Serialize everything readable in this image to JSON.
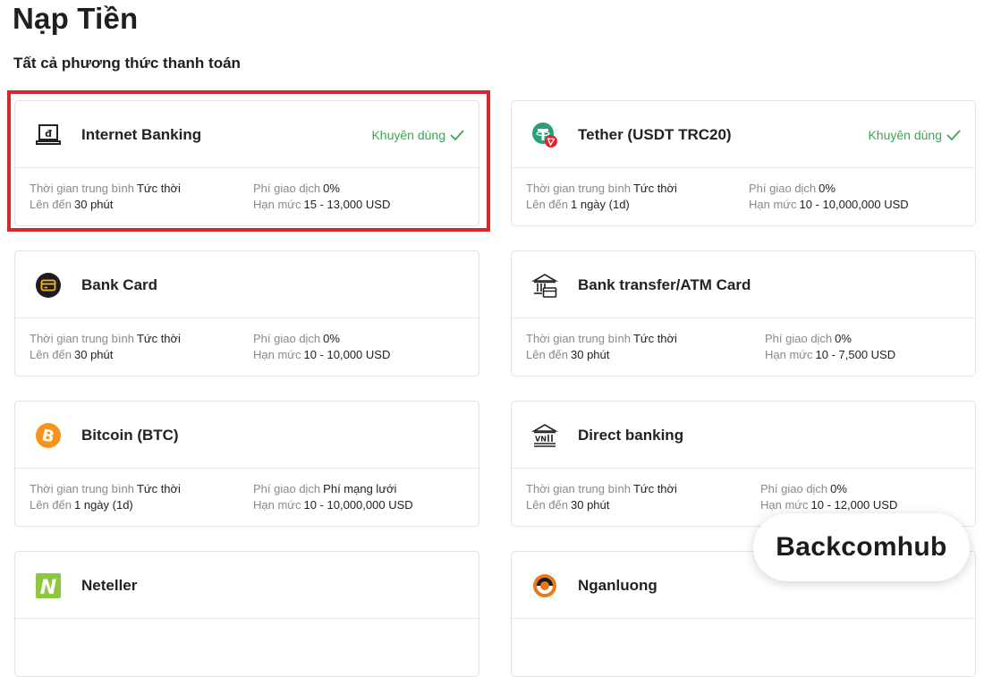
{
  "page": {
    "title": "Nạp Tiền",
    "section_title": "Tất cả phương thức thanh toán"
  },
  "labels": {
    "avg_time": "Thời gian trung bình",
    "up_to": "Lên đến",
    "fee": "Phí giao dịch",
    "limit": "Hạn mức"
  },
  "colors": {
    "recommended": "#3aa655",
    "highlight_border": "#d7262d"
  },
  "methods": [
    {
      "name": "Internet Banking",
      "icon": "laptop-dong-icon",
      "recommended": "Khuyên dùng",
      "avg_time": "Tức thời",
      "up_to": "30 phút",
      "fee": "0%",
      "limit": "15 - 13,000 USD"
    },
    {
      "name": "Tether (USDT TRC20)",
      "icon": "tether-icon",
      "recommended": "Khuyên dùng",
      "avg_time": "Tức thời",
      "up_to": "1 ngày (1d)",
      "fee": "0%",
      "limit": "10 - 10,000,000 USD"
    },
    {
      "name": "Bank Card",
      "icon": "card-icon",
      "avg_time": "Tức thời",
      "up_to": "30 phút",
      "fee": "0%",
      "limit": "10 - 10,000 USD"
    },
    {
      "name": "Bank transfer/ATM Card",
      "icon": "bank-building-icon",
      "avg_time": "Tức thời",
      "up_to": "30 phút",
      "fee": "0%",
      "limit": "10 - 7,500 USD"
    },
    {
      "name": "Bitcoin (BTC)",
      "icon": "bitcoin-icon",
      "avg_time": "Tức thời",
      "up_to": "1 ngày (1d)",
      "fee": "Phí mạng lưới",
      "limit": "10 - 10,000,000 USD"
    },
    {
      "name": "Direct banking",
      "icon": "vn-bank-icon",
      "avg_time": "Tức thời",
      "up_to": "30 phút",
      "fee": "0%",
      "limit": "10 - 12,000 USD"
    },
    {
      "name": "Neteller",
      "icon": "neteller-icon"
    },
    {
      "name": "Nganluong",
      "icon": "nganluong-icon"
    }
  ],
  "watermark": "Backcomhub"
}
